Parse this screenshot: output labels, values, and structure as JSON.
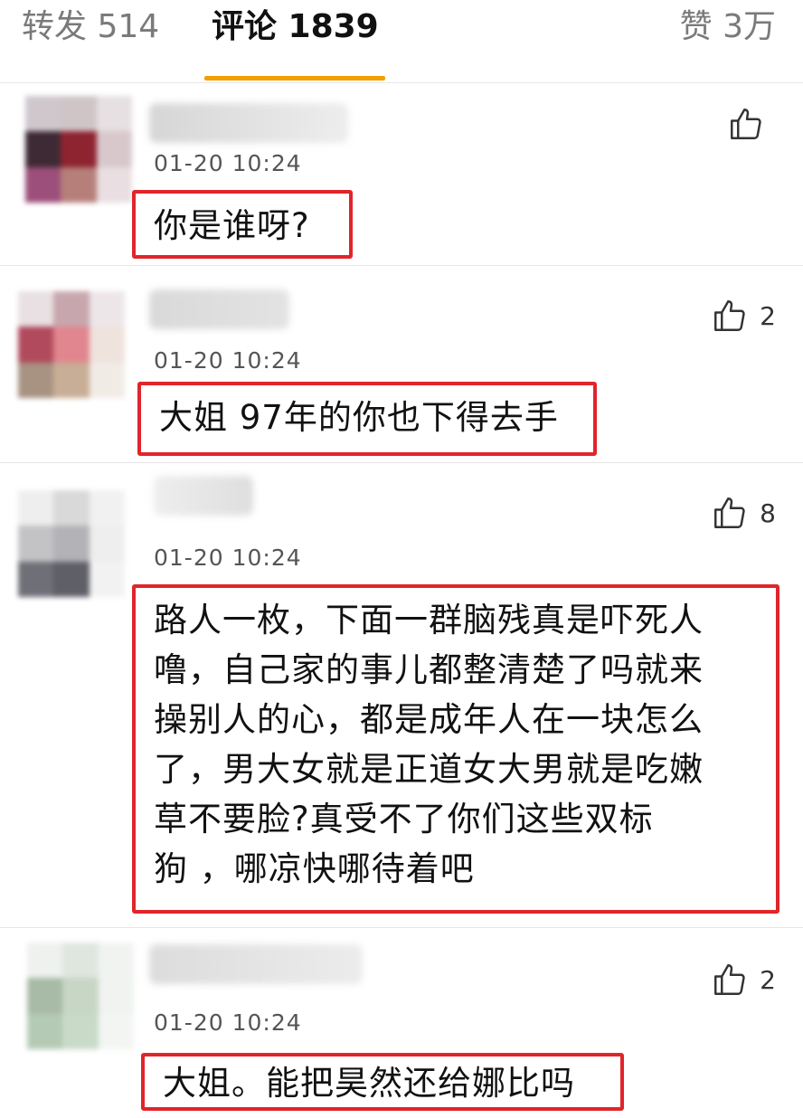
{
  "tabs": {
    "repost": "转发 514",
    "comments": "评论 1839",
    "likes": "赞 3万"
  },
  "colors": {
    "accent": "#f0a000",
    "highlight_box": "#e0252b"
  },
  "comments": [
    {
      "time": "01-20 10:24",
      "likes": "",
      "text": "你是谁呀?"
    },
    {
      "time": "01-20 10:24",
      "likes": "2",
      "text": "大姐 97年的你也下得去手"
    },
    {
      "time": "01-20 10:24",
      "likes": "8",
      "text_lines": [
        "路人一枚，下面一群脑残真是吓死人",
        "噜，自己家的事儿都整清楚了吗就来",
        "操别人的心，都是成年人在一块怎么",
        "了，男大女就是正道女大男就是吃嫩",
        "草不要脸?真受不了你们这些双标",
        "狗 ，哪凉快哪待着吧"
      ]
    },
    {
      "time": "01-20 10:24",
      "likes": "2",
      "text": "大姐。能把昊然还给娜比吗"
    }
  ],
  "icons": {
    "like": "thumbs-up-icon"
  }
}
